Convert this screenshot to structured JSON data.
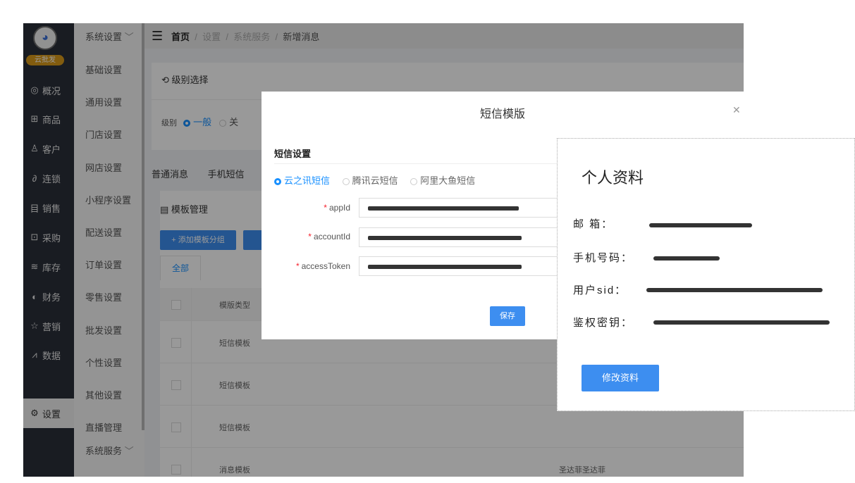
{
  "brand": {
    "badge": "云批发"
  },
  "nav_main": [
    {
      "icon": "◎",
      "icon_name": "overview-icon",
      "label": "概况"
    },
    {
      "icon": "⊞",
      "icon_name": "goods-icon",
      "label": "商品"
    },
    {
      "icon": "♙",
      "icon_name": "customer-icon",
      "label": "客户"
    },
    {
      "icon": "∂",
      "icon_name": "chain-icon",
      "label": "连锁"
    },
    {
      "icon": "目",
      "icon_name": "sales-icon",
      "label": "销售"
    },
    {
      "icon": "⊡",
      "icon_name": "purchase-icon",
      "label": "采购"
    },
    {
      "icon": "≋",
      "icon_name": "inventory-icon",
      "label": "库存"
    },
    {
      "icon": "◐",
      "icon_name": "finance-icon",
      "label": "财务"
    },
    {
      "icon": "☆",
      "icon_name": "marketing-icon",
      "label": "营销"
    },
    {
      "icon": "⩘",
      "icon_name": "data-icon",
      "label": "数据"
    },
    {
      "icon": "⚙",
      "icon_name": "settings-icon",
      "label": "设置"
    }
  ],
  "nav_sub": {
    "header": "系统设置",
    "items": [
      "基础设置",
      "通用设置",
      "门店设置",
      "网店设置",
      "小程序设置",
      "配送设置",
      "订单设置",
      "零售设置",
      "批发设置",
      "个性设置",
      "其他设置",
      "直播管理"
    ],
    "footer": "系统服务"
  },
  "breadcrumb": {
    "home": "首页",
    "sep": "/",
    "l1": "设置",
    "l2": "系统服务",
    "current": "新增消息"
  },
  "level_card": {
    "title": "级别选择",
    "level_label": "级别",
    "opt1": "一般",
    "opt2": "关"
  },
  "msg_tabs": [
    "普通消息",
    "手机短信"
  ],
  "template_card": {
    "title": "模板管理",
    "add_btn": "+ 添加模板分组",
    "tab_all": "全部",
    "col_type": "模版类型",
    "rows": [
      {
        "type": "短信模板",
        "content": ""
      },
      {
        "type": "短信模板",
        "content": ""
      },
      {
        "type": "短信模板",
        "content": ""
      },
      {
        "type": "消息模板",
        "content": "圣达菲圣达菲"
      }
    ]
  },
  "modal": {
    "title": "短信模版",
    "section": "短信设置",
    "providers": [
      "云之讯短信",
      "腾讯云短信",
      "阿里大鱼短信"
    ],
    "selected_provider": "云之讯短信",
    "fields": [
      {
        "label": "appId",
        "value": ""
      },
      {
        "label": "accountId",
        "value": ""
      },
      {
        "label": "accessToken",
        "value": ""
      }
    ],
    "save": "保存"
  },
  "profile": {
    "title": "个人资料",
    "fields": [
      {
        "label": "邮 箱："
      },
      {
        "label": "手机号码："
      },
      {
        "label": "用户sid："
      },
      {
        "label": "鉴权密钥："
      }
    ],
    "button": "修改资料"
  }
}
